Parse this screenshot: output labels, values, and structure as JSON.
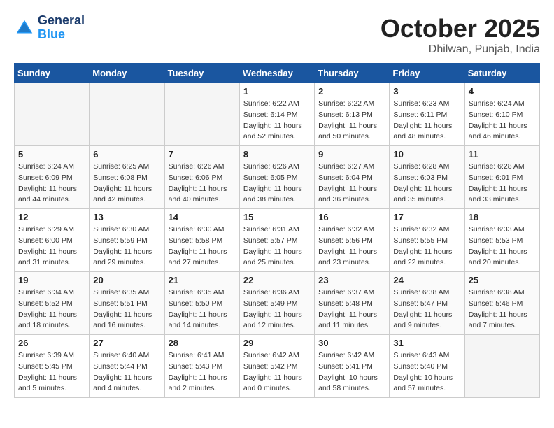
{
  "logo": {
    "line1": "General",
    "line2": "Blue"
  },
  "title": "October 2025",
  "subtitle": "Dhilwan, Punjab, India",
  "weekdays": [
    "Sunday",
    "Monday",
    "Tuesday",
    "Wednesday",
    "Thursday",
    "Friday",
    "Saturday"
  ],
  "weeks": [
    [
      {
        "day": "",
        "info": ""
      },
      {
        "day": "",
        "info": ""
      },
      {
        "day": "",
        "info": ""
      },
      {
        "day": "1",
        "info": "Sunrise: 6:22 AM\nSunset: 6:14 PM\nDaylight: 11 hours\nand 52 minutes."
      },
      {
        "day": "2",
        "info": "Sunrise: 6:22 AM\nSunset: 6:13 PM\nDaylight: 11 hours\nand 50 minutes."
      },
      {
        "day": "3",
        "info": "Sunrise: 6:23 AM\nSunset: 6:11 PM\nDaylight: 11 hours\nand 48 minutes."
      },
      {
        "day": "4",
        "info": "Sunrise: 6:24 AM\nSunset: 6:10 PM\nDaylight: 11 hours\nand 46 minutes."
      }
    ],
    [
      {
        "day": "5",
        "info": "Sunrise: 6:24 AM\nSunset: 6:09 PM\nDaylight: 11 hours\nand 44 minutes."
      },
      {
        "day": "6",
        "info": "Sunrise: 6:25 AM\nSunset: 6:08 PM\nDaylight: 11 hours\nand 42 minutes."
      },
      {
        "day": "7",
        "info": "Sunrise: 6:26 AM\nSunset: 6:06 PM\nDaylight: 11 hours\nand 40 minutes."
      },
      {
        "day": "8",
        "info": "Sunrise: 6:26 AM\nSunset: 6:05 PM\nDaylight: 11 hours\nand 38 minutes."
      },
      {
        "day": "9",
        "info": "Sunrise: 6:27 AM\nSunset: 6:04 PM\nDaylight: 11 hours\nand 36 minutes."
      },
      {
        "day": "10",
        "info": "Sunrise: 6:28 AM\nSunset: 6:03 PM\nDaylight: 11 hours\nand 35 minutes."
      },
      {
        "day": "11",
        "info": "Sunrise: 6:28 AM\nSunset: 6:01 PM\nDaylight: 11 hours\nand 33 minutes."
      }
    ],
    [
      {
        "day": "12",
        "info": "Sunrise: 6:29 AM\nSunset: 6:00 PM\nDaylight: 11 hours\nand 31 minutes."
      },
      {
        "day": "13",
        "info": "Sunrise: 6:30 AM\nSunset: 5:59 PM\nDaylight: 11 hours\nand 29 minutes."
      },
      {
        "day": "14",
        "info": "Sunrise: 6:30 AM\nSunset: 5:58 PM\nDaylight: 11 hours\nand 27 minutes."
      },
      {
        "day": "15",
        "info": "Sunrise: 6:31 AM\nSunset: 5:57 PM\nDaylight: 11 hours\nand 25 minutes."
      },
      {
        "day": "16",
        "info": "Sunrise: 6:32 AM\nSunset: 5:56 PM\nDaylight: 11 hours\nand 23 minutes."
      },
      {
        "day": "17",
        "info": "Sunrise: 6:32 AM\nSunset: 5:55 PM\nDaylight: 11 hours\nand 22 minutes."
      },
      {
        "day": "18",
        "info": "Sunrise: 6:33 AM\nSunset: 5:53 PM\nDaylight: 11 hours\nand 20 minutes."
      }
    ],
    [
      {
        "day": "19",
        "info": "Sunrise: 6:34 AM\nSunset: 5:52 PM\nDaylight: 11 hours\nand 18 minutes."
      },
      {
        "day": "20",
        "info": "Sunrise: 6:35 AM\nSunset: 5:51 PM\nDaylight: 11 hours\nand 16 minutes."
      },
      {
        "day": "21",
        "info": "Sunrise: 6:35 AM\nSunset: 5:50 PM\nDaylight: 11 hours\nand 14 minutes."
      },
      {
        "day": "22",
        "info": "Sunrise: 6:36 AM\nSunset: 5:49 PM\nDaylight: 11 hours\nand 12 minutes."
      },
      {
        "day": "23",
        "info": "Sunrise: 6:37 AM\nSunset: 5:48 PM\nDaylight: 11 hours\nand 11 minutes."
      },
      {
        "day": "24",
        "info": "Sunrise: 6:38 AM\nSunset: 5:47 PM\nDaylight: 11 hours\nand 9 minutes."
      },
      {
        "day": "25",
        "info": "Sunrise: 6:38 AM\nSunset: 5:46 PM\nDaylight: 11 hours\nand 7 minutes."
      }
    ],
    [
      {
        "day": "26",
        "info": "Sunrise: 6:39 AM\nSunset: 5:45 PM\nDaylight: 11 hours\nand 5 minutes."
      },
      {
        "day": "27",
        "info": "Sunrise: 6:40 AM\nSunset: 5:44 PM\nDaylight: 11 hours\nand 4 minutes."
      },
      {
        "day": "28",
        "info": "Sunrise: 6:41 AM\nSunset: 5:43 PM\nDaylight: 11 hours\nand 2 minutes."
      },
      {
        "day": "29",
        "info": "Sunrise: 6:42 AM\nSunset: 5:42 PM\nDaylight: 11 hours\nand 0 minutes."
      },
      {
        "day": "30",
        "info": "Sunrise: 6:42 AM\nSunset: 5:41 PM\nDaylight: 10 hours\nand 58 minutes."
      },
      {
        "day": "31",
        "info": "Sunrise: 6:43 AM\nSunset: 5:40 PM\nDaylight: 10 hours\nand 57 minutes."
      },
      {
        "day": "",
        "info": ""
      }
    ]
  ]
}
